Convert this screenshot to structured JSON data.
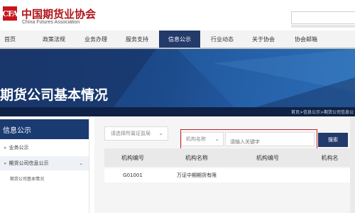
{
  "header": {
    "logo_mark": "CFA",
    "org_name_cn": "中国期货业协会",
    "org_name_en": "China Futures Association",
    "search_placeholder": ""
  },
  "nav": {
    "items": [
      {
        "label": "首页"
      },
      {
        "label": "政策法规"
      },
      {
        "label": "业务办理"
      },
      {
        "label": "服务支持"
      },
      {
        "label": "信息公示",
        "active": true
      },
      {
        "label": "行业动态"
      },
      {
        "label": "关于协会"
      },
      {
        "label": "协会邮箱"
      }
    ]
  },
  "banner": {
    "title": "期货公司基本情况",
    "breadcrumb": "首页>信息公示>期货公司信息公"
  },
  "sidebar": {
    "header": "信息公示",
    "items": [
      {
        "label": "业务公示"
      },
      {
        "label": "期货公司信息公示"
      }
    ],
    "sub_item": "期货公司基本情况"
  },
  "filters": {
    "region_select": "请选择所属证监局",
    "org_select": "机构名称",
    "keyword_placeholder": "请输入关键字",
    "search_button": "搜索"
  },
  "table": {
    "headers": [
      "机构编号",
      "机构名称",
      "机构编号",
      "机构名"
    ],
    "rows": [
      [
        "G01001",
        "万证中期期货有限",
        "",
        ""
      ]
    ]
  },
  "colors": {
    "brand_red": "#c8161d",
    "nav_active": "#233a6b",
    "banner_blue": "#1c4a8a"
  }
}
